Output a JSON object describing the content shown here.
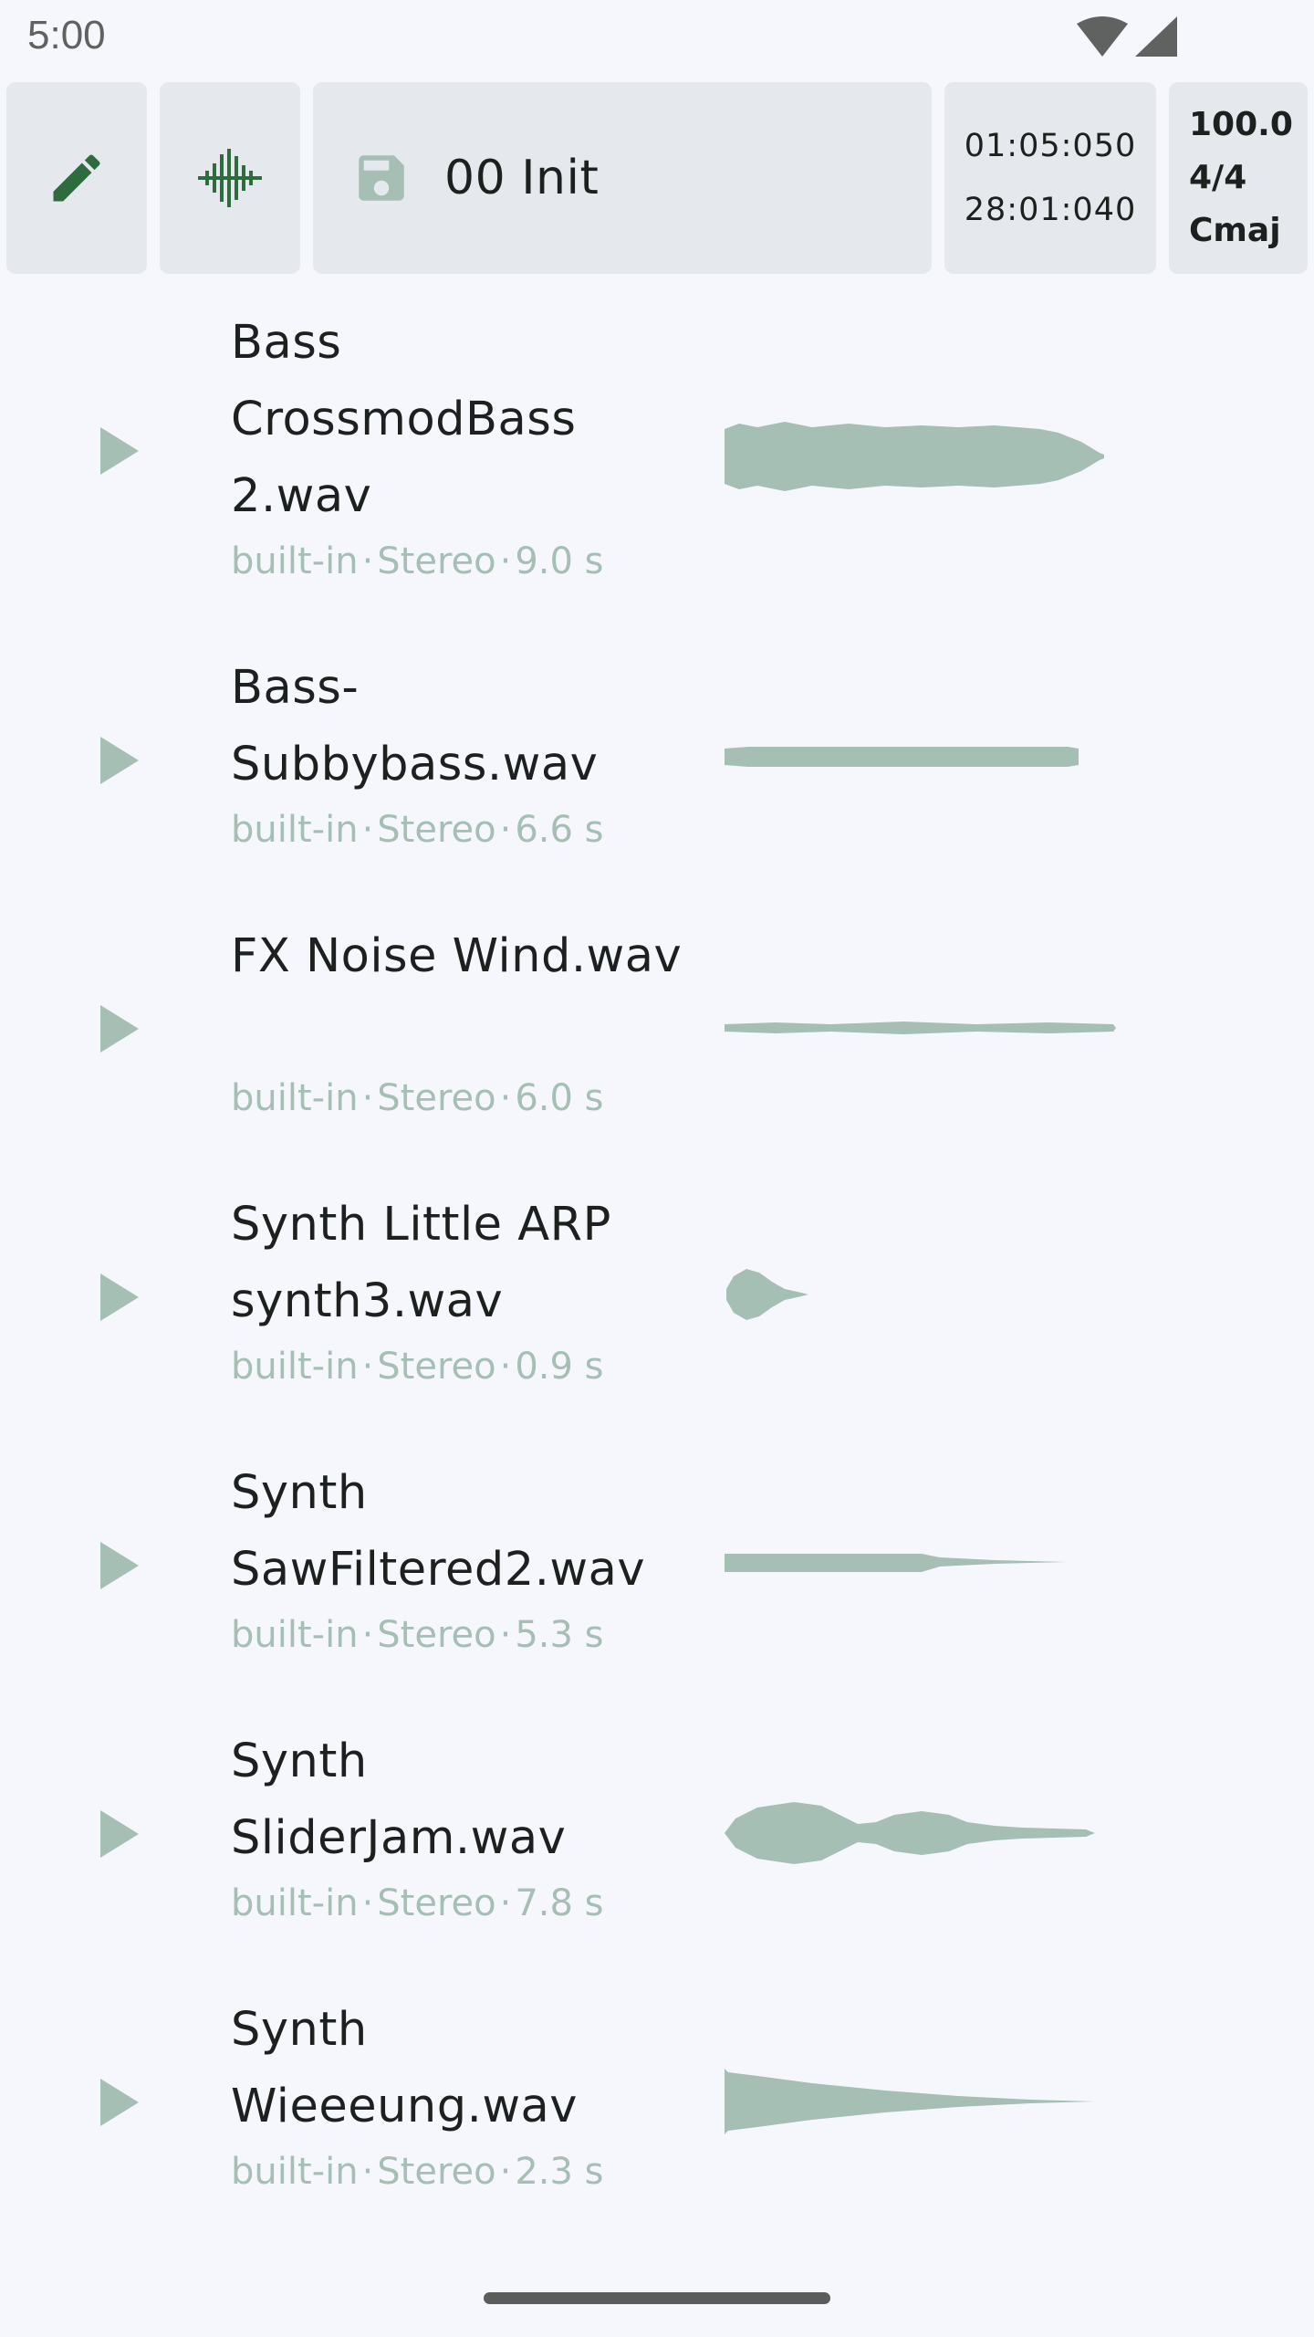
{
  "status_bar": {
    "time": "5:00"
  },
  "toolbar": {
    "project_name": "00 Init",
    "position_time": "01:05:050",
    "total_time": "28:01:040",
    "tempo": "100.0",
    "time_signature": "4/4",
    "key": "Cmaj"
  },
  "colors": {
    "accent_dark": "#2e6b3f",
    "muted_green": "#a5bfb5",
    "button_bg": "#e5e8ed",
    "background": "#f6f7fc"
  },
  "samples": [
    {
      "name": "Bass CrossmodBass 2.wav",
      "source": "built-in",
      "channels": "Stereo",
      "duration": "9.0 s"
    },
    {
      "name": "Bass-Subbybass.wav",
      "source": "built-in",
      "channels": "Stereo",
      "duration": "6.6 s"
    },
    {
      "name": "FX Noise Wind.wav",
      "source": "built-in",
      "channels": "Stereo",
      "duration": "6.0 s"
    },
    {
      "name": "Synth Little ARP synth3.wav",
      "source": "built-in",
      "channels": "Stereo",
      "duration": "0.9 s"
    },
    {
      "name": "Synth SawFiltered2.wav",
      "source": "built-in",
      "channels": "Stereo",
      "duration": "5.3 s"
    },
    {
      "name": "Synth SliderJam.wav",
      "source": "built-in",
      "channels": "Stereo",
      "duration": "7.8 s"
    },
    {
      "name": "Synth Wieeeung.wav",
      "source": "built-in",
      "channels": "Stereo",
      "duration": "2.3 s"
    }
  ]
}
